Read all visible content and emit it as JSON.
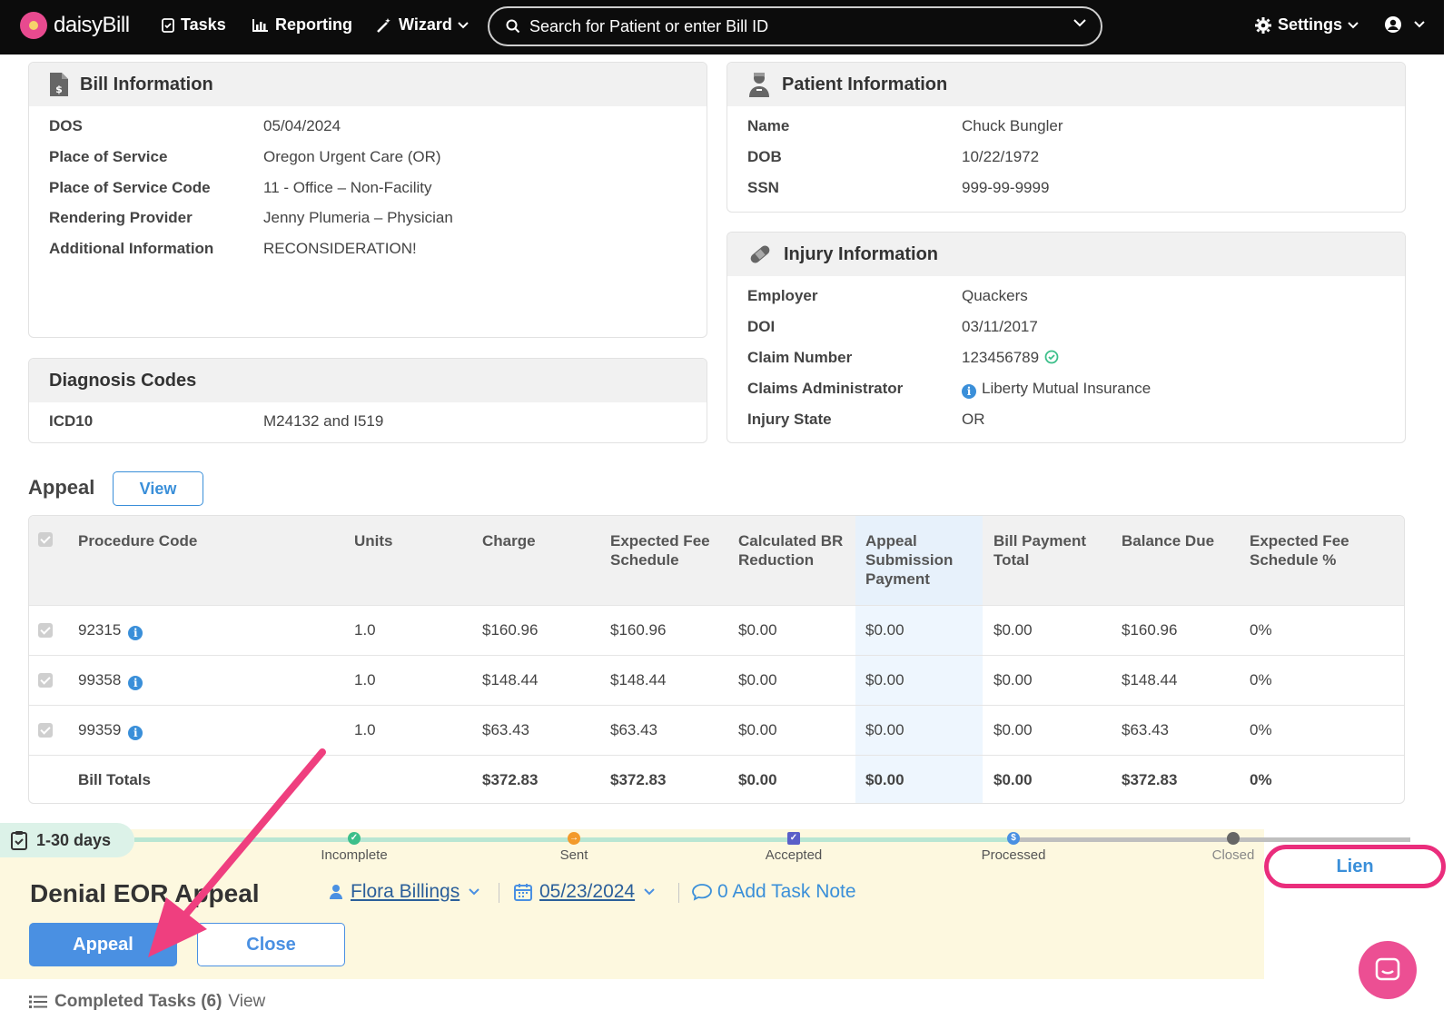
{
  "nav": {
    "brand": "daisyBill",
    "tasks": "Tasks",
    "reporting": "Reporting",
    "wizard": "Wizard",
    "search_placeholder": "Search for Patient or enter Bill ID",
    "settings": "Settings"
  },
  "bill_info": {
    "title": "Bill Information",
    "rows": [
      {
        "label": "DOS",
        "value": "05/04/2024"
      },
      {
        "label": "Place of Service",
        "value": "Oregon Urgent Care (OR)"
      },
      {
        "label": "Place of Service Code",
        "value": "11 - Office – Non-Facility"
      },
      {
        "label": "Rendering Provider",
        "value": "Jenny Plumeria – Physician"
      },
      {
        "label": "Additional Information",
        "value": "RECONSIDERATION!"
      }
    ]
  },
  "patient_info": {
    "title": "Patient Information",
    "rows": [
      {
        "label": "Name",
        "value": "Chuck Bungler"
      },
      {
        "label": "DOB",
        "value": "10/22/1972"
      },
      {
        "label": "SSN",
        "value": "999-99-9999"
      }
    ]
  },
  "diagnosis": {
    "title": "Diagnosis Codes",
    "label": "ICD10",
    "value": "M24132 and I519"
  },
  "injury_info": {
    "title": "Injury Information",
    "rows": [
      {
        "label": "Employer",
        "value": "Quackers"
      },
      {
        "label": "DOI",
        "value": "03/11/2017"
      },
      {
        "label": "Claim Number",
        "value": "123456789"
      },
      {
        "label": "Claims Administrator",
        "value": "Liberty Mutual Insurance"
      },
      {
        "label": "Injury State",
        "value": "OR"
      }
    ]
  },
  "appeal": {
    "title": "Appeal",
    "view_label": "View",
    "columns": [
      "Procedure Code",
      "Units",
      "Charge",
      "Expected Fee Schedule",
      "Calculated BR Reduction",
      "Appeal Submission Payment",
      "Bill Payment Total",
      "Balance Due",
      "Expected Fee Schedule %"
    ],
    "rows": [
      {
        "code": "92315",
        "units": "1.0",
        "charge": "$160.96",
        "efs": "$160.96",
        "br": "$0.00",
        "asp": "$0.00",
        "bpt": "$0.00",
        "balance": "$160.96",
        "pct": "0%"
      },
      {
        "code": "99358",
        "units": "1.0",
        "charge": "$148.44",
        "efs": "$148.44",
        "br": "$0.00",
        "asp": "$0.00",
        "bpt": "$0.00",
        "balance": "$148.44",
        "pct": "0%"
      },
      {
        "code": "99359",
        "units": "1.0",
        "charge": "$63.43",
        "efs": "$63.43",
        "br": "$0.00",
        "asp": "$0.00",
        "bpt": "$0.00",
        "balance": "$63.43",
        "pct": "0%"
      }
    ],
    "totals": {
      "label": "Bill Totals",
      "charge": "$372.83",
      "efs": "$372.83",
      "br": "$0.00",
      "asp": "$0.00",
      "bpt": "$0.00",
      "balance": "$372.83",
      "pct": "0%"
    }
  },
  "task": {
    "days": "1-30 days",
    "steps": [
      "Incomplete",
      "Sent",
      "Accepted",
      "Processed",
      "Closed"
    ],
    "title": "Denial EOR Appeal",
    "assignee": "Flora Billings",
    "date": "05/23/2024",
    "note": "0 Add Task Note",
    "appeal_btn": "Appeal",
    "close_btn": "Close",
    "lien_btn": "Lien",
    "completed_label": "Completed Tasks (6)",
    "completed_view": "View"
  },
  "colors": {
    "accent": "#4a90e2",
    "highlight": "#ea2d7c",
    "task_bg": "#fdf8df"
  }
}
